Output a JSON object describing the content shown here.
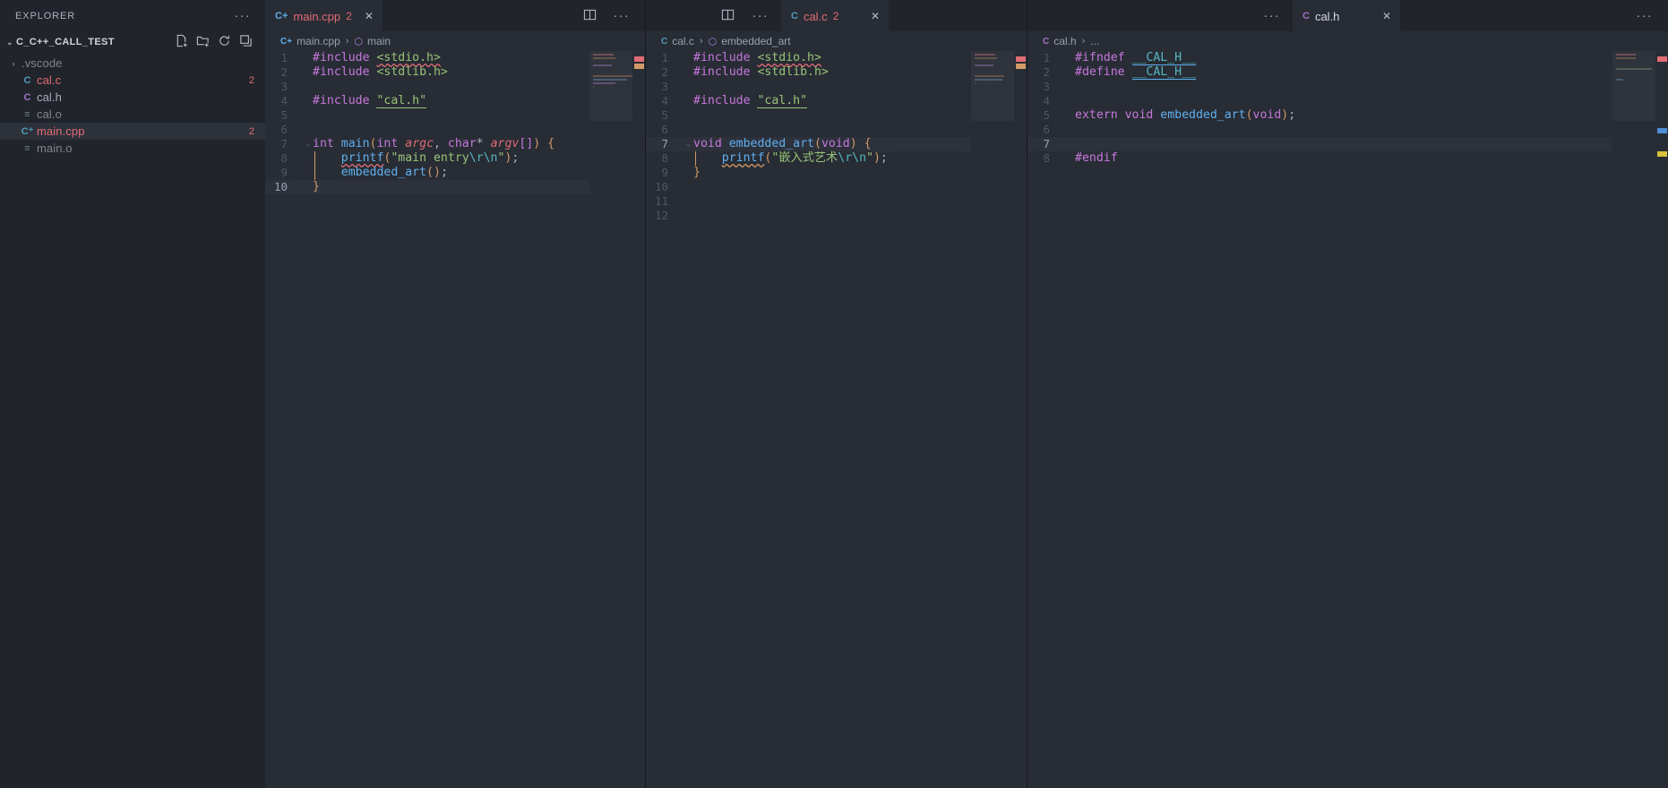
{
  "sidebar": {
    "title": "EXPLORER",
    "more_label": "···",
    "section": {
      "label": "C_C++_CALL_TEST",
      "chevron": "⌄"
    },
    "actions": [
      "new-file",
      "new-folder",
      "refresh",
      "collapse-all"
    ],
    "items": [
      {
        "name": ".vscode",
        "icon": ">",
        "icon_kind": "folder-chevron",
        "color": "dim",
        "badge": "",
        "selected": false,
        "indent": 0
      },
      {
        "name": "cal.c",
        "icon": "C",
        "icon_kind": "c-file",
        "color": "err",
        "badge": "2",
        "selected": false,
        "indent": 1
      },
      {
        "name": "cal.h",
        "icon": "C",
        "icon_kind": "h-file",
        "color": "normal",
        "badge": "",
        "selected": false,
        "indent": 1
      },
      {
        "name": "cal.o",
        "icon": "≡",
        "icon_kind": "binary-file",
        "color": "dim",
        "badge": "",
        "selected": false,
        "indent": 1
      },
      {
        "name": "main.cpp",
        "icon": "C",
        "icon_kind": "cpp-file",
        "color": "err",
        "badge": "2",
        "selected": true,
        "indent": 1
      },
      {
        "name": "main.o",
        "icon": "≡",
        "icon_kind": "binary-file",
        "color": "dim",
        "badge": "",
        "selected": false,
        "indent": 1
      }
    ]
  },
  "groups": [
    {
      "id": "group-1",
      "tab": {
        "icon": "C+",
        "icon_color": "#61afef",
        "name": "main.cpp",
        "count": "2",
        "close": "✕",
        "active": true
      },
      "toolbar": {
        "more": "···",
        "split": "split-editor"
      },
      "breadcrumb": {
        "icon": "C+",
        "file": "main.cpp",
        "sep": "›",
        "symbol_icon": "⬡",
        "symbol": "main"
      },
      "lines": [
        {
          "n": "1",
          "fold": "",
          "cur": false,
          "tokens": [
            {
              "t": "#include ",
              "c": "t-pre"
            },
            {
              "t": "<stdio.h>",
              "c": "t-incl sq-red"
            }
          ]
        },
        {
          "n": "2",
          "fold": "",
          "cur": false,
          "tokens": [
            {
              "t": "#include ",
              "c": "t-pre"
            },
            {
              "t": "<stdlib.h>",
              "c": "t-incl"
            }
          ]
        },
        {
          "n": "3",
          "fold": "",
          "cur": false,
          "tokens": []
        },
        {
          "n": "4",
          "fold": "",
          "cur": false,
          "tokens": [
            {
              "t": "#include ",
              "c": "t-pre"
            },
            {
              "t": "\"cal.h\"",
              "c": "t-incl ul-grn"
            }
          ]
        },
        {
          "n": "5",
          "fold": "",
          "cur": false,
          "tokens": []
        },
        {
          "n": "6",
          "fold": "",
          "cur": false,
          "tokens": []
        },
        {
          "n": "7",
          "fold": "⌄",
          "cur": false,
          "tokens": [
            {
              "t": "int ",
              "c": "t-key"
            },
            {
              "t": "main",
              "c": "t-fn"
            },
            {
              "t": "(",
              "c": "t-par1"
            },
            {
              "t": "int ",
              "c": "t-key"
            },
            {
              "t": "argc",
              "c": "t-var"
            },
            {
              "t": ", ",
              "c": "t-punc"
            },
            {
              "t": "char",
              "c": "t-key"
            },
            {
              "t": "* ",
              "c": "t-plain"
            },
            {
              "t": "argv",
              "c": "t-var"
            },
            {
              "t": "[",
              "c": "t-par2"
            },
            {
              "t": "]",
              "c": "t-par2"
            },
            {
              "t": ")",
              "c": "t-par1"
            },
            {
              "t": " ",
              "c": "t-plain"
            },
            {
              "t": "{",
              "c": "t-brace"
            }
          ]
        },
        {
          "n": "8",
          "fold": "",
          "cur": false,
          "indent": true,
          "tokens": [
            {
              "t": "    ",
              "c": "t-plain"
            },
            {
              "t": "printf",
              "c": "t-fn sq-red"
            },
            {
              "t": "(",
              "c": "t-par1"
            },
            {
              "t": "\"main entry",
              "c": "t-str"
            },
            {
              "t": "\\r\\n",
              "c": "t-esc"
            },
            {
              "t": "\"",
              "c": "t-str"
            },
            {
              "t": ")",
              "c": "t-par1"
            },
            {
              "t": ";",
              "c": "t-punc"
            }
          ]
        },
        {
          "n": "9",
          "fold": "",
          "cur": false,
          "indent": true,
          "tokens": [
            {
              "t": "    ",
              "c": "t-plain"
            },
            {
              "t": "embedded_art",
              "c": "t-fn"
            },
            {
              "t": "(",
              "c": "t-par1"
            },
            {
              "t": ")",
              "c": "t-par1"
            },
            {
              "t": ";",
              "c": "t-punc"
            }
          ]
        },
        {
          "n": "10",
          "fold": "",
          "cur": true,
          "tokens": [
            {
              "t": "}",
              "c": "t-brace"
            }
          ]
        }
      ]
    },
    {
      "id": "group-2",
      "tab": {
        "icon": "C",
        "icon_color": "#519aba",
        "name": "cal.c",
        "count": "2",
        "close": "✕",
        "active": true
      },
      "toolbar": {
        "more": "···",
        "split": "split-editor"
      },
      "breadcrumb": {
        "icon": "C",
        "file": "cal.c",
        "sep": "›",
        "symbol_icon": "⬡",
        "symbol": "embedded_art"
      },
      "lines": [
        {
          "n": "1",
          "fold": "",
          "cur": false,
          "tokens": [
            {
              "t": "#include ",
              "c": "t-pre"
            },
            {
              "t": "<stdio.h>",
              "c": "t-incl sq-red"
            }
          ]
        },
        {
          "n": "2",
          "fold": "",
          "cur": false,
          "tokens": [
            {
              "t": "#include ",
              "c": "t-pre"
            },
            {
              "t": "<stdlib.h>",
              "c": "t-incl"
            }
          ]
        },
        {
          "n": "3",
          "fold": "",
          "cur": false,
          "tokens": []
        },
        {
          "n": "4",
          "fold": "",
          "cur": false,
          "tokens": [
            {
              "t": "#include ",
              "c": "t-pre"
            },
            {
              "t": "\"cal.h\"",
              "c": "t-incl ul-grn"
            }
          ]
        },
        {
          "n": "5",
          "fold": "",
          "cur": false,
          "tokens": []
        },
        {
          "n": "6",
          "fold": "",
          "cur": false,
          "tokens": []
        },
        {
          "n": "7",
          "fold": "⌄",
          "cur": true,
          "tokens": [
            {
              "t": "void ",
              "c": "t-key"
            },
            {
              "t": "embedded_art",
              "c": "t-fn"
            },
            {
              "t": "(",
              "c": "t-par1"
            },
            {
              "t": "void",
              "c": "t-key"
            },
            {
              "t": ")",
              "c": "t-par1"
            },
            {
              "t": " ",
              "c": "t-plain"
            },
            {
              "t": "{",
              "c": "t-brace"
            }
          ]
        },
        {
          "n": "8",
          "fold": "",
          "cur": false,
          "indent": true,
          "tokens": [
            {
              "t": "    ",
              "c": "t-plain"
            },
            {
              "t": "printf",
              "c": "t-fn sq-ylw"
            },
            {
              "t": "(",
              "c": "t-par1"
            },
            {
              "t": "\"嵌入式艺术",
              "c": "t-str"
            },
            {
              "t": "\\r\\n",
              "c": "t-esc"
            },
            {
              "t": "\"",
              "c": "t-str"
            },
            {
              "t": ")",
              "c": "t-par1"
            },
            {
              "t": ";",
              "c": "t-punc"
            }
          ]
        },
        {
          "n": "9",
          "fold": "",
          "cur": false,
          "tokens": [
            {
              "t": "}",
              "c": "t-brace"
            }
          ]
        },
        {
          "n": "10",
          "fold": "",
          "cur": false,
          "tokens": []
        },
        {
          "n": "11",
          "fold": "",
          "cur": false,
          "tokens": []
        },
        {
          "n": "12",
          "fold": "",
          "cur": false,
          "tokens": []
        }
      ]
    },
    {
      "id": "group-3",
      "tab": {
        "icon": "C",
        "icon_color": "#a074c4",
        "name": "cal.h",
        "count": "",
        "close": "✕",
        "active": true
      },
      "toolbar": {
        "more": "···",
        "split": ""
      },
      "breadcrumb": {
        "icon": "C",
        "file": "cal.h",
        "sep": "›",
        "symbol_icon": "",
        "symbol": "..."
      },
      "lines": [
        {
          "n": "1",
          "fold": "",
          "cur": false,
          "tokens": [
            {
              "t": "#ifndef ",
              "c": "t-pre"
            },
            {
              "t": "__CAL_H__",
              "c": "t-macro ul-blue"
            }
          ]
        },
        {
          "n": "2",
          "fold": "",
          "cur": false,
          "tokens": [
            {
              "t": "#define ",
              "c": "t-pre"
            },
            {
              "t": "__CAL_H__",
              "c": "t-macro ul-blue"
            }
          ]
        },
        {
          "n": "3",
          "fold": "",
          "cur": false,
          "tokens": []
        },
        {
          "n": "4",
          "fold": "",
          "cur": false,
          "tokens": []
        },
        {
          "n": "5",
          "fold": "",
          "cur": false,
          "tokens": [
            {
              "t": "extern ",
              "c": "t-key"
            },
            {
              "t": "void ",
              "c": "t-key"
            },
            {
              "t": "embedded_art",
              "c": "t-fn"
            },
            {
              "t": "(",
              "c": "t-par1"
            },
            {
              "t": "void",
              "c": "t-key"
            },
            {
              "t": ")",
              "c": "t-par1"
            },
            {
              "t": ";",
              "c": "t-punc"
            }
          ]
        },
        {
          "n": "6",
          "fold": "",
          "cur": false,
          "tokens": []
        },
        {
          "n": "7",
          "fold": "",
          "cur": true,
          "tokens": []
        },
        {
          "n": "8",
          "fold": "",
          "cur": false,
          "tokens": [
            {
              "t": "#endif",
              "c": "t-pre"
            }
          ]
        }
      ]
    }
  ],
  "colors": {
    "editor_bg": "#282c34",
    "sidebar_bg": "#21252b",
    "tabbar_bg": "#21252b",
    "active_tab_bg": "#282c34",
    "selection_bg": "#2c313a",
    "error": "#e06c75",
    "string": "#98c379",
    "keyword": "#c678dd",
    "function": "#61afef",
    "paren": "#d19a66",
    "line_number": "#4e5666"
  }
}
